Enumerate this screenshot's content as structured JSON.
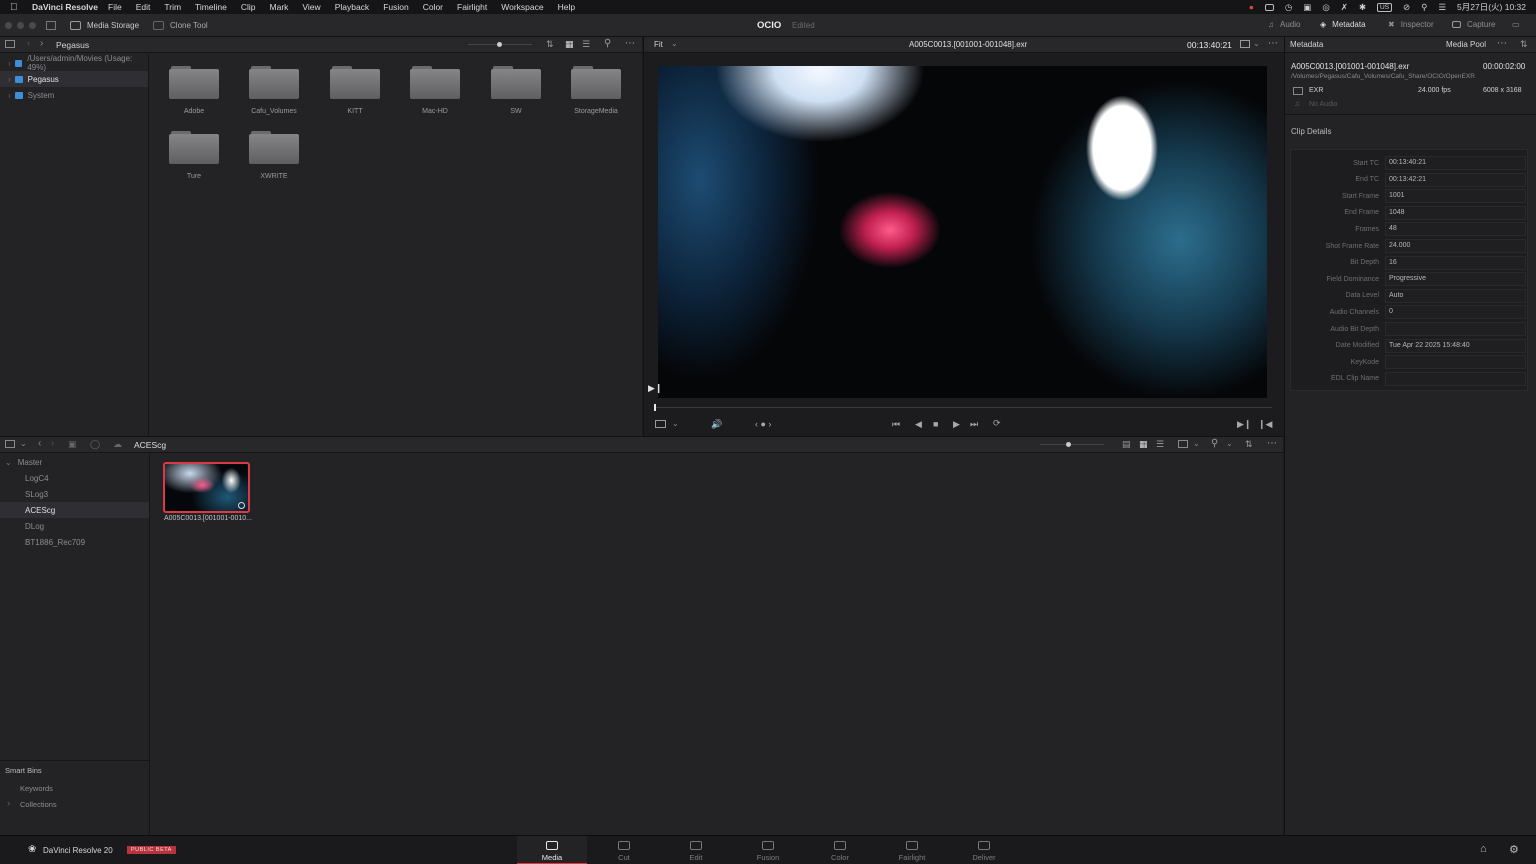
{
  "menubar": {
    "app": "DaVinci Resolve",
    "menus": [
      "File",
      "Edit",
      "Trim",
      "Timeline",
      "Clip",
      "Mark",
      "View",
      "Playback",
      "Fusion",
      "Color",
      "Fairlight",
      "Workspace",
      "Help"
    ],
    "clock": "5月27日(火) 10:32",
    "input_source": "US"
  },
  "titlebar": {
    "media_storage": "Media Storage",
    "clone_tool": "Clone Tool",
    "project": "OCIO",
    "project_state": "Edited",
    "audio": "Audio",
    "metadata": "Metadata",
    "inspector": "Inspector",
    "capture": "Capture"
  },
  "storage": {
    "location": "Pegasus",
    "tree": [
      {
        "label": "/Users/admin/Movies (Usage: 49%)",
        "selected": false
      },
      {
        "label": "Pegasus",
        "selected": true
      },
      {
        "label": "System",
        "selected": false
      }
    ],
    "folders": [
      "Adobe",
      "Cafu_Volumes",
      "KITT",
      "Mac-HD",
      "SW",
      "StorageMedia",
      "Ture",
      "XWRITE"
    ]
  },
  "viewer": {
    "zoom": "Fit",
    "clip_name": "A005C0013.[001001-001048].exr",
    "timecode": "00:13:40:21"
  },
  "metadata": {
    "title": "Metadata",
    "media_pool_tab": "Media Pool",
    "clip_name": "A005C0013.[001001-001048].exr",
    "duration": "00:00:02:00",
    "path": "/Volumes/Pegasus/Cafu_Volumes/Cafu_Share/OCIO/OpenEXR",
    "format": "EXR",
    "fps": "24.000 fps",
    "resolution": "6008 x 3168",
    "audio": "No Audio",
    "section": "Clip Details",
    "details": [
      {
        "key": "Start TC",
        "value": "00:13:40:21"
      },
      {
        "key": "End TC",
        "value": "00:13:42:21"
      },
      {
        "key": "Start Frame",
        "value": "1001"
      },
      {
        "key": "End Frame",
        "value": "1048"
      },
      {
        "key": "Frames",
        "value": "48"
      },
      {
        "key": "Shot Frame Rate",
        "value": "24.000"
      },
      {
        "key": "Bit Depth",
        "value": "16"
      },
      {
        "key": "Field Dominance",
        "value": "Progressive"
      },
      {
        "key": "Data Level",
        "value": "Auto"
      },
      {
        "key": "Audio Channels",
        "value": "0"
      },
      {
        "key": "Audio Bit Depth",
        "value": ""
      },
      {
        "key": "Date Modified",
        "value": "Tue Apr 22 2025 15:48:40"
      },
      {
        "key": "KeyKode",
        "value": ""
      },
      {
        "key": "EDL Clip Name",
        "value": ""
      }
    ]
  },
  "mediapool": {
    "current_bin": "ACEScg",
    "bins": [
      {
        "label": "Master",
        "selected": false
      },
      {
        "label": "LogC4",
        "selected": false
      },
      {
        "label": "SLog3",
        "selected": false
      },
      {
        "label": "ACEScg",
        "selected": true
      },
      {
        "label": "DLog",
        "selected": false
      },
      {
        "label": "BT1886_Rec709",
        "selected": false
      }
    ],
    "smart_bins": "Smart Bins",
    "smart_items": [
      "Keywords",
      "Collections"
    ],
    "clip_label": "A005C0013.[001001-0010..."
  },
  "footer": {
    "brand": "DaVinci Resolve 20",
    "beta": "PUBLIC BETA",
    "pages": [
      {
        "label": "Media",
        "active": true
      },
      {
        "label": "Cut",
        "active": false
      },
      {
        "label": "Edit",
        "active": false
      },
      {
        "label": "Fusion",
        "active": false
      },
      {
        "label": "Color",
        "active": false
      },
      {
        "label": "Fairlight",
        "active": false
      },
      {
        "label": "Deliver",
        "active": false
      }
    ]
  }
}
